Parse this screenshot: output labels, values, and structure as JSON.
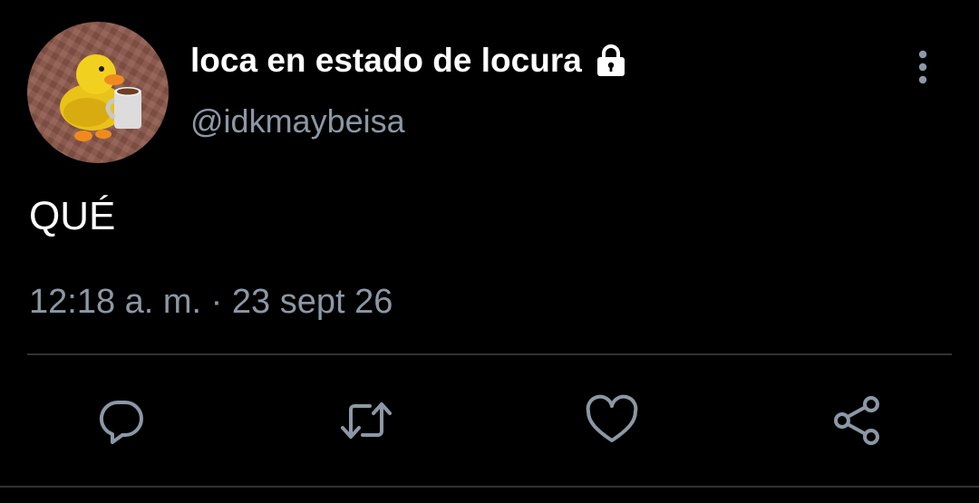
{
  "tweet": {
    "display_name": "loca en estado de locura",
    "handle": "@idkmaybeisa",
    "text": "QUÉ",
    "timestamp": "12:18 a. m. · 23 sept 26",
    "protected_account": true,
    "avatar_icon": "duck-with-mug-avatar"
  },
  "actions": [
    {
      "name": "reply",
      "icon": "reply-icon"
    },
    {
      "name": "retweet",
      "icon": "retweet-icon"
    },
    {
      "name": "like",
      "icon": "heart-icon"
    },
    {
      "name": "share",
      "icon": "share-icon"
    }
  ],
  "colors": {
    "background": "#000000",
    "primary_text": "#ffffff",
    "secondary_text": "#8b98a5",
    "divider": "#2f3336"
  }
}
